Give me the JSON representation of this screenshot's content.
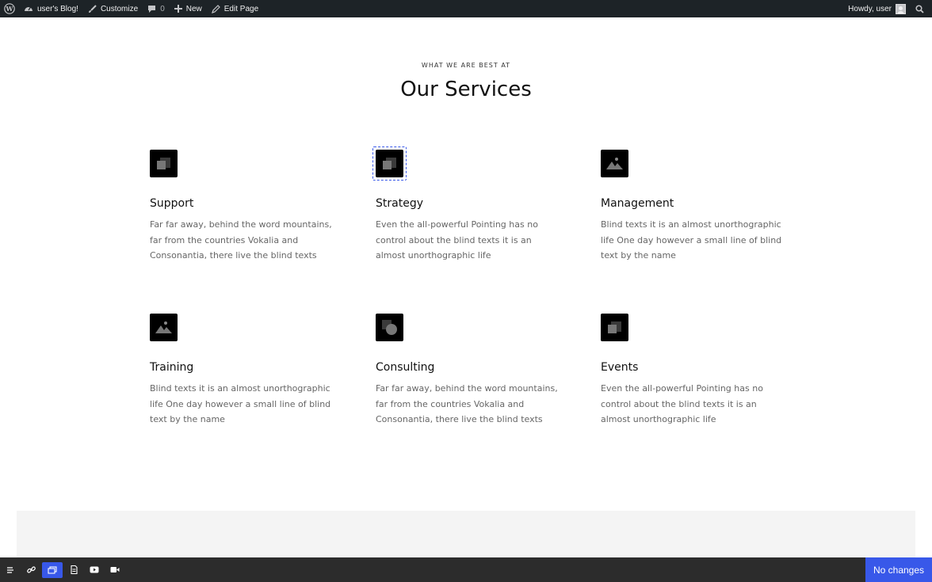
{
  "adminbar": {
    "site_name": "user's Blog!",
    "customize": "Customize",
    "comments_count": "0",
    "new": "New",
    "edit_page": "Edit Page",
    "howdy": "Howdy, user"
  },
  "section": {
    "eyebrow": "WHAT WE ARE BEST AT",
    "title": "Our Services"
  },
  "services": [
    {
      "title": "Support",
      "text": "Far far away, behind the word mountains, far from the countries Vokalia and Consonantia, there live the blind texts",
      "icon": "stacked-squares-icon"
    },
    {
      "title": "Strategy",
      "text": "Even the all-powerful Pointing has no control about the blind texts it is an almost unorthographic life",
      "icon": "stacked-squares-icon"
    },
    {
      "title": "Management",
      "text": "Blind texts it is an almost unorthographic life One day however a small line of blind text by the name",
      "icon": "mountain-image-icon"
    },
    {
      "title": "Training",
      "text": "Blind texts it is an almost unorthographic life One day however a small line of blind text by the name",
      "icon": "mountain-image-icon"
    },
    {
      "title": "Consulting",
      "text": "Far far away, behind the word mountains, far from the countries Vokalia and Consonantia, there live the blind texts",
      "icon": "square-circle-icon"
    },
    {
      "title": "Events",
      "text": "Even the all-powerful Pointing has no control about the blind texts it is an almost unorthographic life",
      "icon": "stacked-squares-icon"
    }
  ],
  "toolbar": {
    "status": "No changes"
  },
  "colors": {
    "adminbar": "#1d2327",
    "accent": "#3858e9",
    "toolbar": "#2c2c2c"
  }
}
